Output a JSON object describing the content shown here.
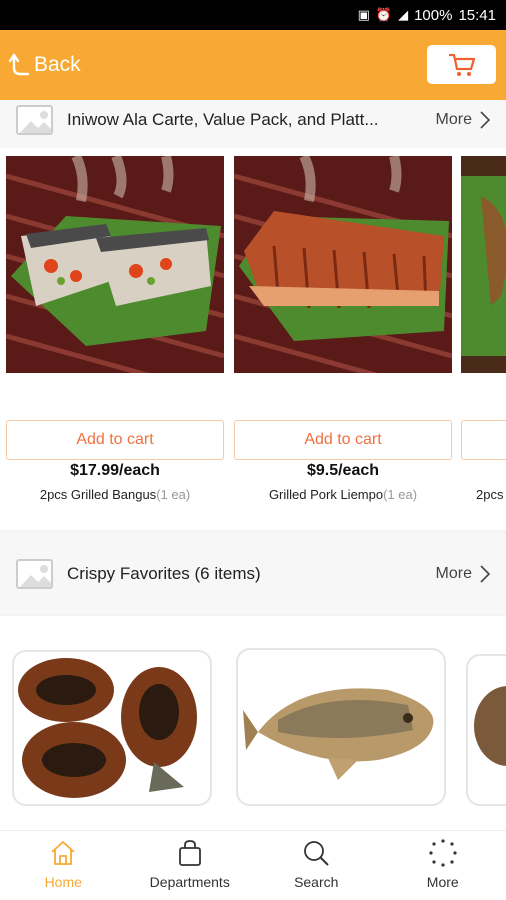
{
  "status_bar": {
    "battery": "100%",
    "time": "15:41"
  },
  "app_bar": {
    "back_label": "Back"
  },
  "sections": [
    {
      "title": "Iniwow Ala Carte, Value Pack, and Platt...",
      "more_label": "More",
      "products": [
        {
          "add_label": "Add to cart",
          "price": "$17.99/each",
          "name": "2pcs Grilled Bangus",
          "unit": "(1 ea)"
        },
        {
          "add_label": "Add to cart",
          "price": "$9.5/each",
          "name": "Grilled Pork Liempo",
          "unit": "(1 ea)"
        },
        {
          "name_partial": "2pcs"
        }
      ]
    },
    {
      "title": "Crispy Favorites (6 items)",
      "more_label": "More"
    }
  ],
  "bottom_nav": [
    {
      "label": "Home",
      "icon": "home-icon",
      "active": true
    },
    {
      "label": "Departments",
      "icon": "bag-icon",
      "active": false
    },
    {
      "label": "Search",
      "icon": "search-icon",
      "active": false
    },
    {
      "label": "More",
      "icon": "more-dots-icon",
      "active": false
    }
  ],
  "colors": {
    "accent": "#f7a934",
    "add_to_cart_text": "#f07040"
  }
}
